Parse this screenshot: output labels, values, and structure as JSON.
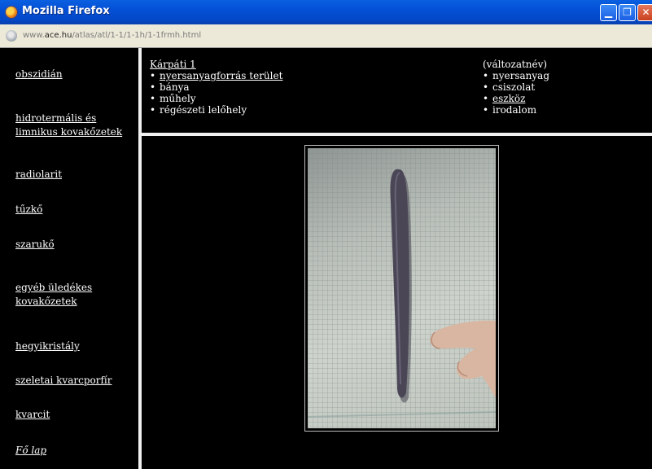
{
  "window": {
    "title": "Mozilla Firefox"
  },
  "urlbar": {
    "url_prefix": "www.",
    "url_domain": "ace.hu",
    "url_path": "/atlas/atl/1-1/1-1h/1-1frmh.html"
  },
  "sidebar": {
    "items": [
      {
        "label": "obszidián"
      },
      {
        "label": "hidrotermális és limnikus kovakőzetek"
      },
      {
        "label": "radiolarit"
      },
      {
        "label": "tűzkő"
      },
      {
        "label": "szarukő"
      },
      {
        "label": "egyéb üledékes kovakőzetek"
      },
      {
        "label": "hegyikristály"
      },
      {
        "label": "szeletai kvarcporfír"
      },
      {
        "label": "kvarcit"
      },
      {
        "label": "Fő lap"
      }
    ]
  },
  "top": {
    "left": {
      "title": "Kárpáti 1",
      "items": [
        {
          "label": "nyersanyagforrás terület"
        },
        {
          "label": "bánya"
        },
        {
          "label": "műhely"
        },
        {
          "label": "régészeti lelőhely"
        }
      ]
    },
    "right": {
      "title": "(változatnév)",
      "items": [
        {
          "label": "nyersanyag"
        },
        {
          "label": "csiszolat"
        },
        {
          "label": "eszköz"
        },
        {
          "label": "irodalom"
        }
      ]
    },
    "bullet": "•"
  },
  "icons": {
    "window_minimize": "minimize-icon",
    "window_restore": "restore-icon",
    "window_close": "close-icon",
    "browser_logo": "firefox-icon",
    "site_identity": "globe-icon"
  },
  "colors": {
    "page_background": "#000000",
    "link_text": "#ffffff",
    "frame_separator": "#f0f0f0",
    "titlebar": "#0450d6"
  }
}
